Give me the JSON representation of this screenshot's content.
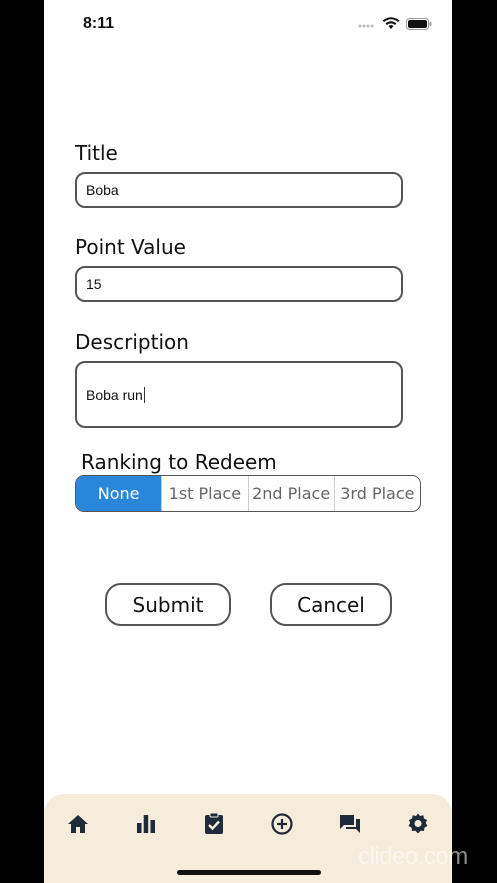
{
  "status_bar": {
    "time": "8:11"
  },
  "form": {
    "title_label": "Title",
    "title_value": "Boba",
    "point_label": "Point Value",
    "point_value": "15",
    "description_label": "Description",
    "description_value": "Boba run",
    "ranking_label": "Ranking to Redeem",
    "ranking_options": [
      "None",
      "1st Place",
      "2nd Place",
      "3rd Place"
    ],
    "ranking_selected": "None"
  },
  "actions": {
    "submit": "Submit",
    "cancel": "Cancel"
  },
  "tabbar": {
    "icons": [
      "home-icon",
      "bar-chart-icon",
      "clipboard-check-icon",
      "add-circle-icon",
      "chat-icon",
      "gear-icon"
    ]
  },
  "watermark": "clideo.com",
  "colors": {
    "accent": "#2a86d8",
    "tabbar_bg": "#f6ecdc"
  }
}
